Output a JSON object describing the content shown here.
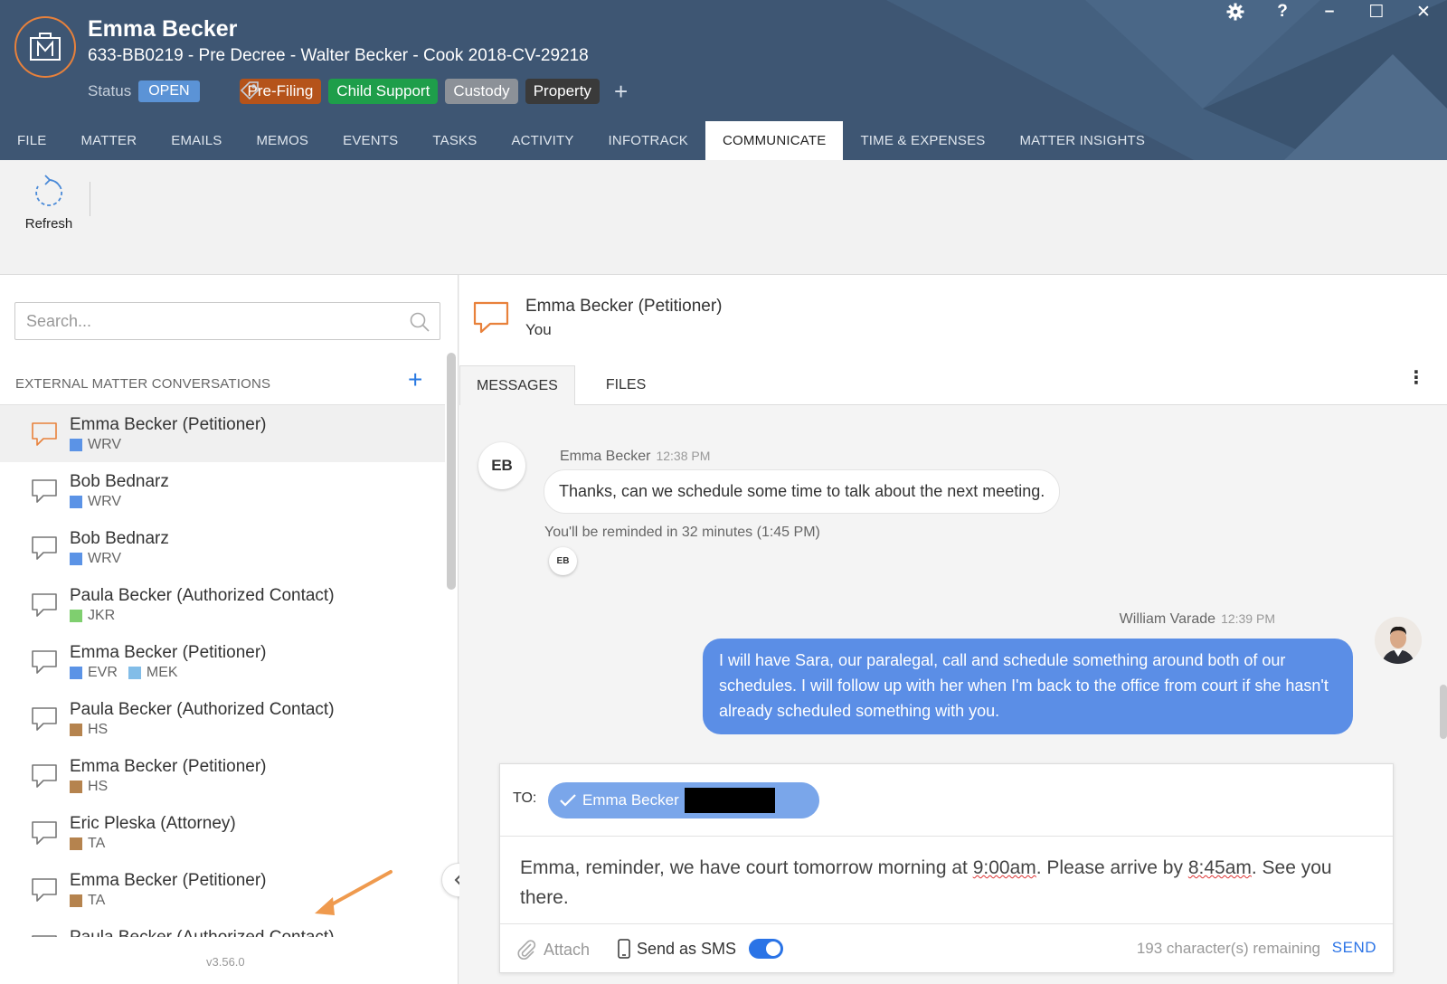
{
  "header": {
    "client_name": "Emma Becker",
    "matter_line": "633-BB0219 - Pre Decree - Walter Becker - Cook 2018-CV-29218",
    "status_label": "Status",
    "status_value": "OPEN",
    "tags": [
      {
        "label": "Pre-Filing",
        "color": "#b5531a"
      },
      {
        "label": "Child Support",
        "color": "#1e9e4a"
      },
      {
        "label": "Custody",
        "color": "#8c9198"
      },
      {
        "label": "Property",
        "color": "#3a3a3a"
      }
    ],
    "icons": {
      "logo": "briefcase-m-logo",
      "tag": "tag-icon",
      "add": "plus-icon",
      "settings": "gear-icon",
      "help": "question-icon",
      "minimize": "minimize-icon",
      "maximize": "maximize-icon",
      "close": "close-icon"
    }
  },
  "window_controls": {
    "help": "?",
    "minimize": "–",
    "maximize": "☐",
    "close": "✕"
  },
  "nav": {
    "tabs": [
      "FILE",
      "MATTER",
      "EMAILS",
      "MEMOS",
      "EVENTS",
      "TASKS",
      "ACTIVITY",
      "INFOTRACK",
      "COMMUNICATE",
      "TIME & EXPENSES",
      "MATTER INSIGHTS"
    ],
    "active": "COMMUNICATE"
  },
  "toolbar": {
    "refresh_label": "Refresh"
  },
  "sidebar": {
    "search_placeholder": "Search...",
    "section_title": "EXTERNAL MATTER CONVERSATIONS",
    "add": "+",
    "conversations": [
      {
        "name": "Emma Becker (Petitioner)",
        "tags": [
          {
            "code": "WRV",
            "color": "#5b93e6"
          }
        ],
        "active": true
      },
      {
        "name": "Bob Bednarz",
        "tags": [
          {
            "code": "WRV",
            "color": "#5b93e6"
          }
        ]
      },
      {
        "name": "Bob Bednarz",
        "tags": [
          {
            "code": "WRV",
            "color": "#5b93e6"
          }
        ]
      },
      {
        "name": "Paula Becker (Authorized Contact)",
        "tags": [
          {
            "code": "JKR",
            "color": "#7fcf6f"
          }
        ]
      },
      {
        "name": "Emma Becker (Petitioner)",
        "tags": [
          {
            "code": "EVR",
            "color": "#5b93e6"
          },
          {
            "code": "MEK",
            "color": "#82bde8"
          }
        ]
      },
      {
        "name": "Paula Becker (Authorized Contact)",
        "tags": [
          {
            "code": "HS",
            "color": "#b5834e"
          }
        ]
      },
      {
        "name": "Emma Becker (Petitioner)",
        "tags": [
          {
            "code": "HS",
            "color": "#b5834e"
          }
        ]
      },
      {
        "name": "Eric Pleska (Attorney)",
        "tags": [
          {
            "code": "TA",
            "color": "#b5834e"
          }
        ]
      },
      {
        "name": "Emma Becker (Petitioner)",
        "tags": [
          {
            "code": "TA",
            "color": "#b5834e"
          }
        ]
      },
      {
        "name": "Paula Becker (Authorized Contact)",
        "tags": []
      }
    ],
    "version": "v3.56.0"
  },
  "conversation": {
    "title": "Emma Becker (Petitioner)",
    "subtitle": "You",
    "tabs": [
      "MESSAGES",
      "FILES"
    ],
    "active_tab": "MESSAGES",
    "messages": [
      {
        "direction": "in",
        "initials": "EB",
        "sender": "Emma Becker",
        "time": "12:38 PM",
        "text": "Thanks, can we schedule some time to talk about the next meeting.",
        "reminder": "You'll be reminded in 32 minutes (1:45 PM)",
        "read_by": "EB"
      },
      {
        "direction": "out",
        "sender": "William Varade",
        "time": "12:39 PM",
        "text": "I will have Sara, our paralegal, call and schedule something around both of our schedules. I will follow up with her when I'm back to the office from court if she hasn't already scheduled something with you."
      }
    ]
  },
  "composer": {
    "to_label": "TO:",
    "recipient": "Emma Becker",
    "body_parts": [
      "Emma, reminder, we have court tomorrow morning at ",
      "9:00am",
      ". Please arrive by ",
      "8:45am",
      ". See you there."
    ],
    "attach_label": "Attach",
    "sms_label": "Send as SMS",
    "sms_enabled": true,
    "remaining": "193 character(s) remaining",
    "send_label": "SEND"
  },
  "colors": {
    "header_bg": "#3e5673",
    "accent": "#2a73e6",
    "logo_orange": "#e8813b",
    "bubble_out": "#5b8ee6"
  }
}
